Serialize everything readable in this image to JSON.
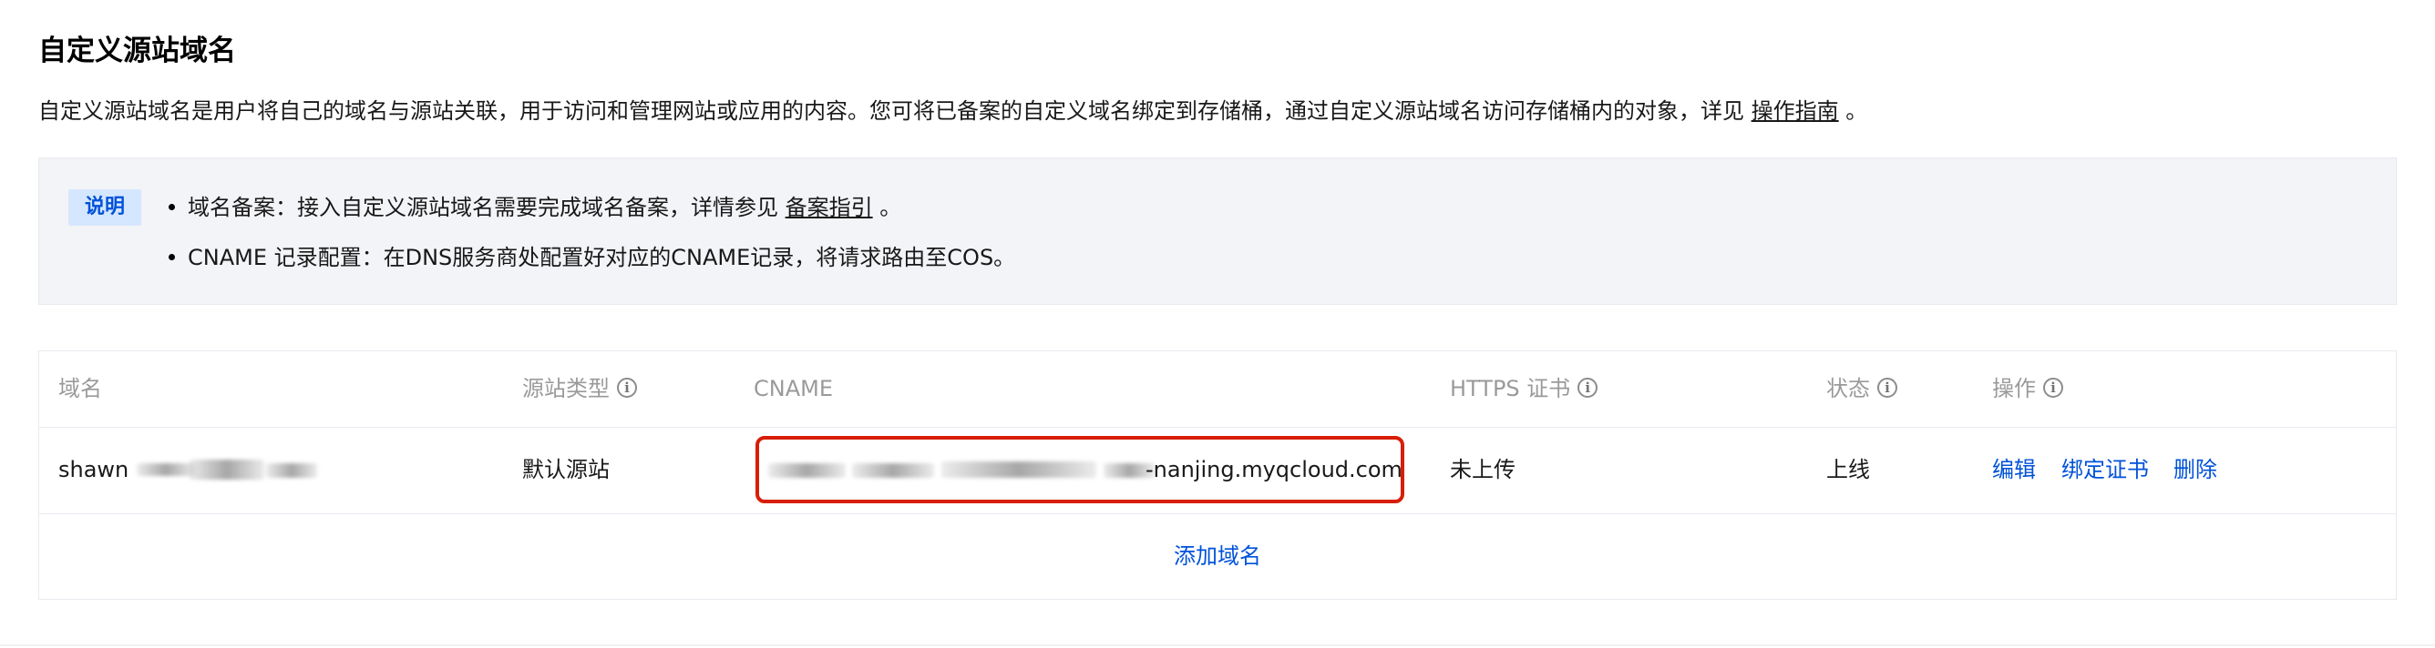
{
  "page": {
    "title": "自定义源站域名",
    "description": "自定义源站域名是用户将自己的域名与源站关联，用于访问和管理网站或应用的内容。您可将已备案的自定义域名绑定到存储桶，通过自定义源站域名访问存储桶内的对象，详见",
    "description_link": "操作指南",
    "description_tail": "。"
  },
  "notice": {
    "tag": "说明",
    "items": [
      {
        "text": "域名备案：接入自定义源站域名需要完成域名备案，详情参见",
        "link": "备案指引",
        "tail": "。"
      },
      {
        "text": "CNAME 记录配置：在DNS服务商处配置好对应的CNAME记录，将请求路由至COS。"
      }
    ]
  },
  "table": {
    "columns": [
      {
        "label": "域名",
        "info_icon": false
      },
      {
        "label": "源站类型",
        "info_icon": true
      },
      {
        "label": "CNAME",
        "info_icon": false
      },
      {
        "label": "HTTPS 证书",
        "info_icon": true
      },
      {
        "label": "状态",
        "info_icon": true
      },
      {
        "label": "操作",
        "info_icon": true
      }
    ],
    "rows": [
      {
        "domain_visible": "shawn",
        "origin_type": "默认源站",
        "cname_visible": "-nanjing.myqcloud.com",
        "https": "未上传",
        "status": "上线",
        "actions": [
          "编辑",
          "绑定证书",
          "删除"
        ]
      }
    ],
    "add_label": "添加域名"
  },
  "icons": {
    "info": "info-circle-icon"
  },
  "colors": {
    "link": "#0052d9",
    "highlight_frame": "#d81e06",
    "tag_bg": "#d5e7ff",
    "notice_bg": "#f3f4f7"
  }
}
